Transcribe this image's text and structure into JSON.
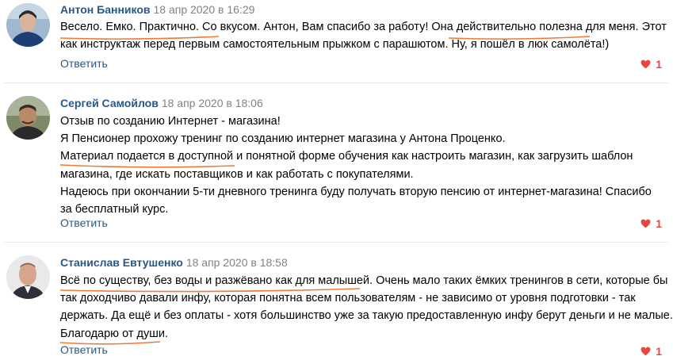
{
  "comments": [
    {
      "author": "Антон Банников",
      "date": "18 апр 2020 в 16:29",
      "lines": [
        "Весело. Емко. Практично. Со вкусом. Антон, Вам спасибо за работу! Она действительно полезна для меня. Этот",
        "как инструктаж перед первым самостоятельным прыжком с парашютом. Ну, я пошёл в люк самолёта!)"
      ],
      "reply": "Ответить",
      "likes": "1"
    },
    {
      "author": "Сергей Самойлов",
      "date": "18 апр 2020 в 18:06",
      "lines": [
        "Отзыв по созданию Интернет - магазина!",
        "Я Пенсионер прохожу тренинг по созданию интернет магазина у Антона Проценко.",
        "Материал подается в доступной и понятной форме обучения как настроить магазин, как загрузить шаблон",
        "магазина, где искать поставщиков и как работать с покупателями.",
        "Надеюсь при окончании 5-ти дневного тренинга буду получать вторую пенсию от интернет-магазина! Спасибо",
        "за бесплатный курс."
      ],
      "reply": "Ответить",
      "likes": "1"
    },
    {
      "author": "Станислав Евтушенко",
      "date": "18 апр 2020 в 18:58",
      "lines": [
        "Всё по существу, без воды и разжёвано как для малышей. Очень мало таких ёмких тренингов в сети, которые бы",
        "так доходчиво давали инфу, которая понятна всем пользователям - не зависимо от уровня подготовки - так",
        "держать. Да ещё и без оплаты - хотя большинство уже за такую предоставленную инфу берут деньги и не малые.",
        "Благодарю от души."
      ],
      "reply": "Ответить",
      "likes": "1"
    }
  ],
  "colors": {
    "author": "#2a5885",
    "date": "#828282",
    "like": "#e64646",
    "underline": "#f07a3a"
  },
  "icons": {
    "like": "heart-icon"
  }
}
